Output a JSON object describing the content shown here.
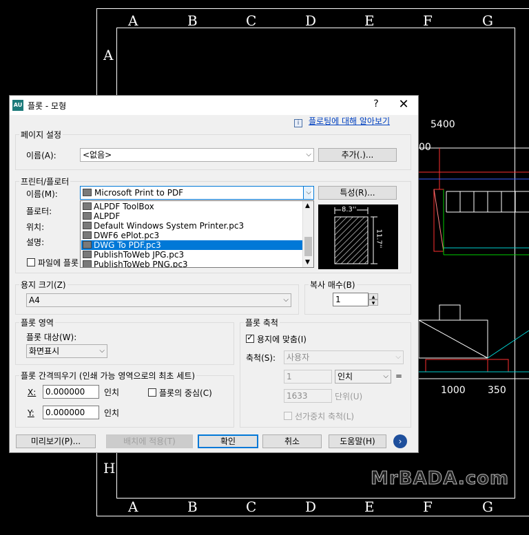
{
  "cad": {
    "columns_top": [
      "A",
      "B",
      "C",
      "D",
      "E",
      "F",
      "G"
    ],
    "columns_bottom": [
      "A",
      "B",
      "C",
      "D",
      "E",
      "F",
      "G"
    ],
    "rows": [
      "A",
      "H"
    ],
    "dim_5400": "5400",
    "dim_1000": "1000",
    "dim_350": "350",
    "dim_00": "00",
    "watermark": "MrBADA.com"
  },
  "dialog": {
    "title": "플롯 - 모형",
    "app_icon_text": "AU",
    "help_button": "?",
    "close_button": "✕",
    "help_link": "플로팅에 대해 알아보기",
    "page_setup": {
      "group_label": "페이지 설정",
      "name_label": "이름(A):",
      "name_value": "<없음>",
      "add_button": "추가(.)..."
    },
    "printer": {
      "group_label": "프린터/플로터",
      "name_label": "이름(M):",
      "name_value": "Microsoft Print to PDF",
      "properties_button": "특성(R)...",
      "plotter_label": "플로터:",
      "location_label": "위치:",
      "description_label": "설명:",
      "plot_to_file_label": "파일에 플롯",
      "dropdown_items": [
        "ALPDF ToolBox",
        "ALPDF",
        "Default Windows System Printer.pc3",
        "DWF6 ePlot.pc3",
        "DWG To PDF.pc3",
        "PublishToWeb JPG.pc3",
        "PublishToWeb PNG.pc3"
      ],
      "selected_index": 4,
      "preview_width": "8.3''",
      "preview_height": "11.7''"
    },
    "paper_size": {
      "group_label": "용지 크기(Z)",
      "value": "A4"
    },
    "copies": {
      "group_label": "복사 매수(B)",
      "value": "1"
    },
    "plot_area": {
      "group_label": "플롯 영역",
      "what_label": "플롯 대상(W):",
      "what_value": "화면표시"
    },
    "plot_offset": {
      "group_label": "플롯 간격띄우기 (인쇄 가능 영역으로의 최초 세트)",
      "x_label": "X:",
      "x_value": "0.000000",
      "x_unit": "인치",
      "y_label": "Y:",
      "y_value": "0.000000",
      "y_unit": "인치",
      "center_label": "플롯의 중심(C)"
    },
    "plot_scale": {
      "group_label": "플롯 축척",
      "fit_label": "용지에 맞춤(I)",
      "scale_label": "축척(S):",
      "scale_value": "사용자",
      "value1": "1",
      "unit1": "인치",
      "equals": "=",
      "value2": "1633",
      "unit2": "단위(U)",
      "lineweight_label": "선가중치 축척(L)"
    },
    "buttons": {
      "preview": "미리보기(P)...",
      "apply_layout": "배치에 적용(T)",
      "ok": "확인",
      "cancel": "취소",
      "help": "도움말(H)",
      "more": "›"
    }
  }
}
